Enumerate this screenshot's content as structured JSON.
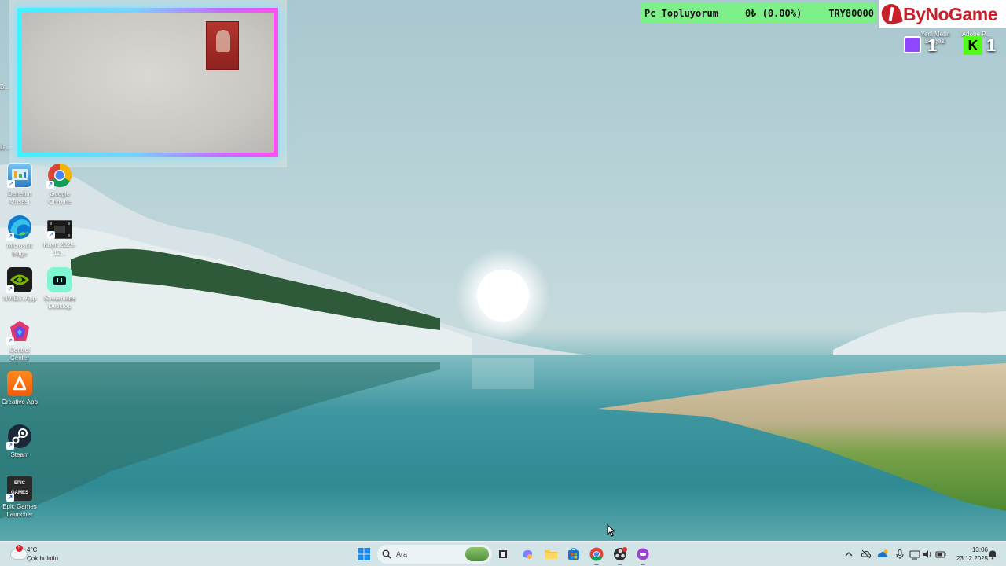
{
  "desktop": {
    "icons": [
      {
        "label": "Denetim Masası",
        "icon": "control-panel-icon"
      },
      {
        "label": "Google Chrome",
        "icon": "chrome-icon"
      },
      {
        "label": "Microsoft Edge",
        "icon": "edge-icon"
      },
      {
        "label": "Kayıt 2025-12...",
        "icon": "video-file-icon"
      },
      {
        "label": "NVIDIA App",
        "icon": "nvidia-icon"
      },
      {
        "label": "Streamlabs Desktop",
        "icon": "streamlabs-icon"
      },
      {
        "label": "Control Center",
        "icon": "control-center-icon"
      },
      {
        "label": "Creative App",
        "icon": "creative-app-icon"
      },
      {
        "label": "Steam",
        "icon": "steam-icon"
      },
      {
        "label": "Epic Games Launcher",
        "icon": "epic-games-icon"
      }
    ],
    "partial_labels": [
      "B...",
      "D..."
    ],
    "epic_badge": "EPIC GAMES"
  },
  "overlay": {
    "donation": {
      "title": "Pc Topluyorum",
      "progress_text": "0₺ (0.00%)",
      "progress": 0,
      "goal": "TRY80000"
    },
    "brand": "ByNoGame",
    "alerts": [
      {
        "label": "Yeni Metin Belgesi",
        "count": "1",
        "icon": "twitch-icon"
      },
      {
        "label": "Adobe P...",
        "count": "1",
        "icon": "kick-icon"
      }
    ],
    "kick_letter": "K"
  },
  "taskbar": {
    "weather": {
      "temp": "4°C",
      "condition": "Çok bulutlu",
      "badge": "5"
    },
    "search": {
      "placeholder": "Ara"
    },
    "pinned": [
      {
        "name": "task-view",
        "icon": "task-view-icon"
      },
      {
        "name": "copilot",
        "icon": "copilot-icon"
      },
      {
        "name": "file-explorer",
        "icon": "folder-icon"
      },
      {
        "name": "microsoft-store",
        "icon": "store-icon"
      },
      {
        "name": "chrome",
        "icon": "chrome-icon"
      },
      {
        "name": "obs",
        "icon": "recording-app-icon"
      },
      {
        "name": "purple-app",
        "icon": "purple-app-icon"
      }
    ],
    "clock": {
      "time": "13:06",
      "date": "23.12.2025"
    }
  },
  "colors": {
    "donation_bar": "#7ef08a",
    "brand_red": "#c8202a",
    "cam_border_cyan": "#3ef2ff",
    "cam_border_magenta": "#ff4ff0",
    "twitch_purple": "#9146ff",
    "kick_green": "#53fc18"
  }
}
